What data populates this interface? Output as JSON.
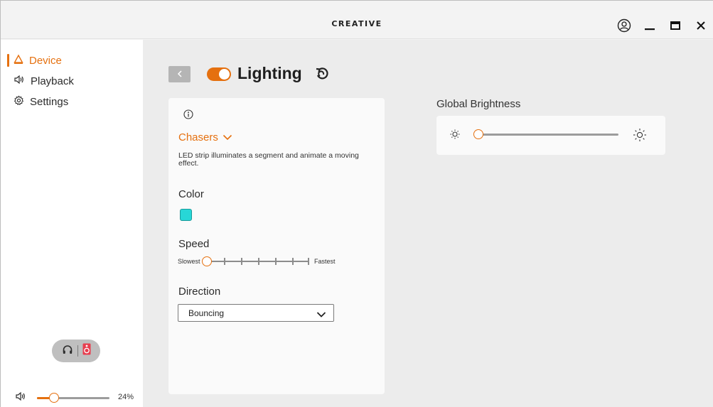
{
  "titlebar": {
    "brand": "CREATIVE",
    "icons": [
      "user-icon",
      "minimize-icon",
      "maximize-icon",
      "close-icon"
    ]
  },
  "sidebar": {
    "items": [
      {
        "label": "Device",
        "icon": "device-icon",
        "active": true
      },
      {
        "label": "Playback",
        "icon": "speaker-icon",
        "active": false
      },
      {
        "label": "Settings",
        "icon": "gear-icon",
        "active": false
      }
    ],
    "output_toggle": {
      "left_icon": "headphones-icon",
      "right_icon": "speaker-device-icon",
      "active": "speaker"
    },
    "volume": {
      "value": 0.24,
      "label": "24%"
    }
  },
  "header": {
    "title": "Lighting",
    "lighting_enabled": true
  },
  "effect": {
    "name": "Chasers",
    "description": "LED strip illuminates a segment and animate a moving effect."
  },
  "color": {
    "label": "Color",
    "swatch": "#27d7d7"
  },
  "speed": {
    "label": "Speed",
    "min_label": "Slowest",
    "max_label": "Fastest",
    "steps": 7,
    "value_step": 0
  },
  "direction": {
    "label": "Direction",
    "value": "Bouncing"
  },
  "brightness": {
    "label": "Global Brightness",
    "value": 0
  },
  "colors": {
    "accent": "#e5700f",
    "panel": "#fafafa",
    "background": "#ececec"
  }
}
